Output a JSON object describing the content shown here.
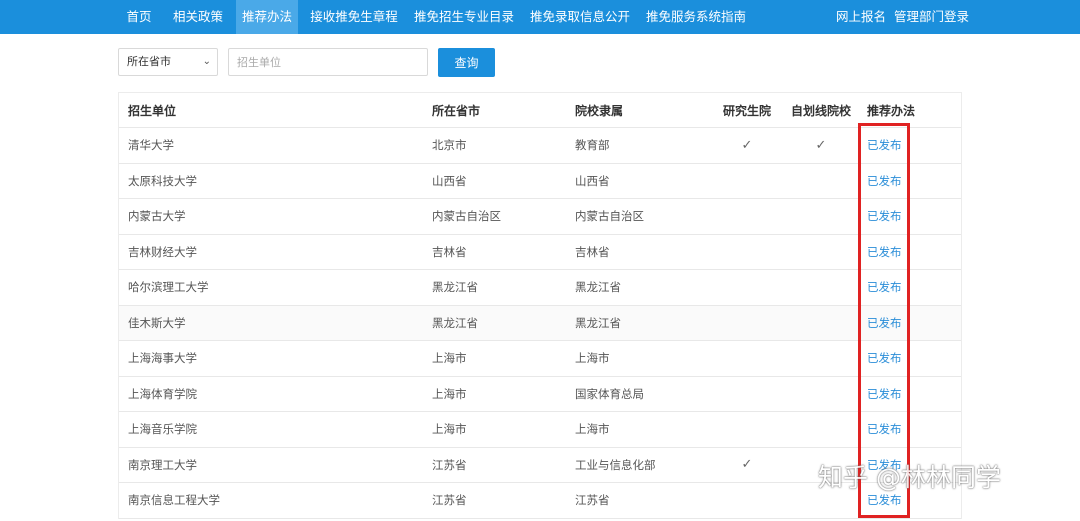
{
  "nav": {
    "items": [
      "首页",
      "相关政策",
      "推荐办法",
      "接收推免生章程",
      "推免招生专业目录",
      "推免录取信息公开",
      "推免服务系统指南"
    ],
    "right": [
      "网上报名",
      "管理部门登录"
    ]
  },
  "filters": {
    "province_select": "所在省市",
    "unit_placeholder": "招生单位",
    "query_button": "查询"
  },
  "table": {
    "headers": [
      "招生单位",
      "所在省市",
      "院校隶属",
      "研究生院",
      "自划线院校",
      "推荐办法"
    ],
    "rows": [
      [
        "清华大学",
        "北京市",
        "教育部",
        "✓",
        "✓",
        "已发布"
      ],
      [
        "太原科技大学",
        "山西省",
        "山西省",
        "",
        "",
        "已发布"
      ],
      [
        "内蒙古大学",
        "内蒙古自治区",
        "内蒙古自治区",
        "",
        "",
        "已发布"
      ],
      [
        "吉林财经大学",
        "吉林省",
        "吉林省",
        "",
        "",
        "已发布"
      ],
      [
        "哈尔滨理工大学",
        "黑龙江省",
        "黑龙江省",
        "",
        "",
        "已发布"
      ],
      [
        "佳木斯大学",
        "黑龙江省",
        "黑龙江省",
        "",
        "",
        "已发布"
      ],
      [
        "上海海事大学",
        "上海市",
        "上海市",
        "",
        "",
        "已发布"
      ],
      [
        "上海体育学院",
        "上海市",
        "国家体育总局",
        "",
        "",
        "已发布"
      ],
      [
        "上海音乐学院",
        "上海市",
        "上海市",
        "",
        "",
        "已发布"
      ],
      [
        "南京理工大学",
        "江苏省",
        "工业与信息化部",
        "✓",
        "",
        "已发布"
      ],
      [
        "南京信息工程大学",
        "江苏省",
        "江苏省",
        "",
        "",
        "已发布"
      ]
    ]
  },
  "watermark": "知乎 @林林同学",
  "colors": {
    "nav": "#1b8fdc",
    "link": "#2b8ed8",
    "highlight": "#e02222"
  }
}
